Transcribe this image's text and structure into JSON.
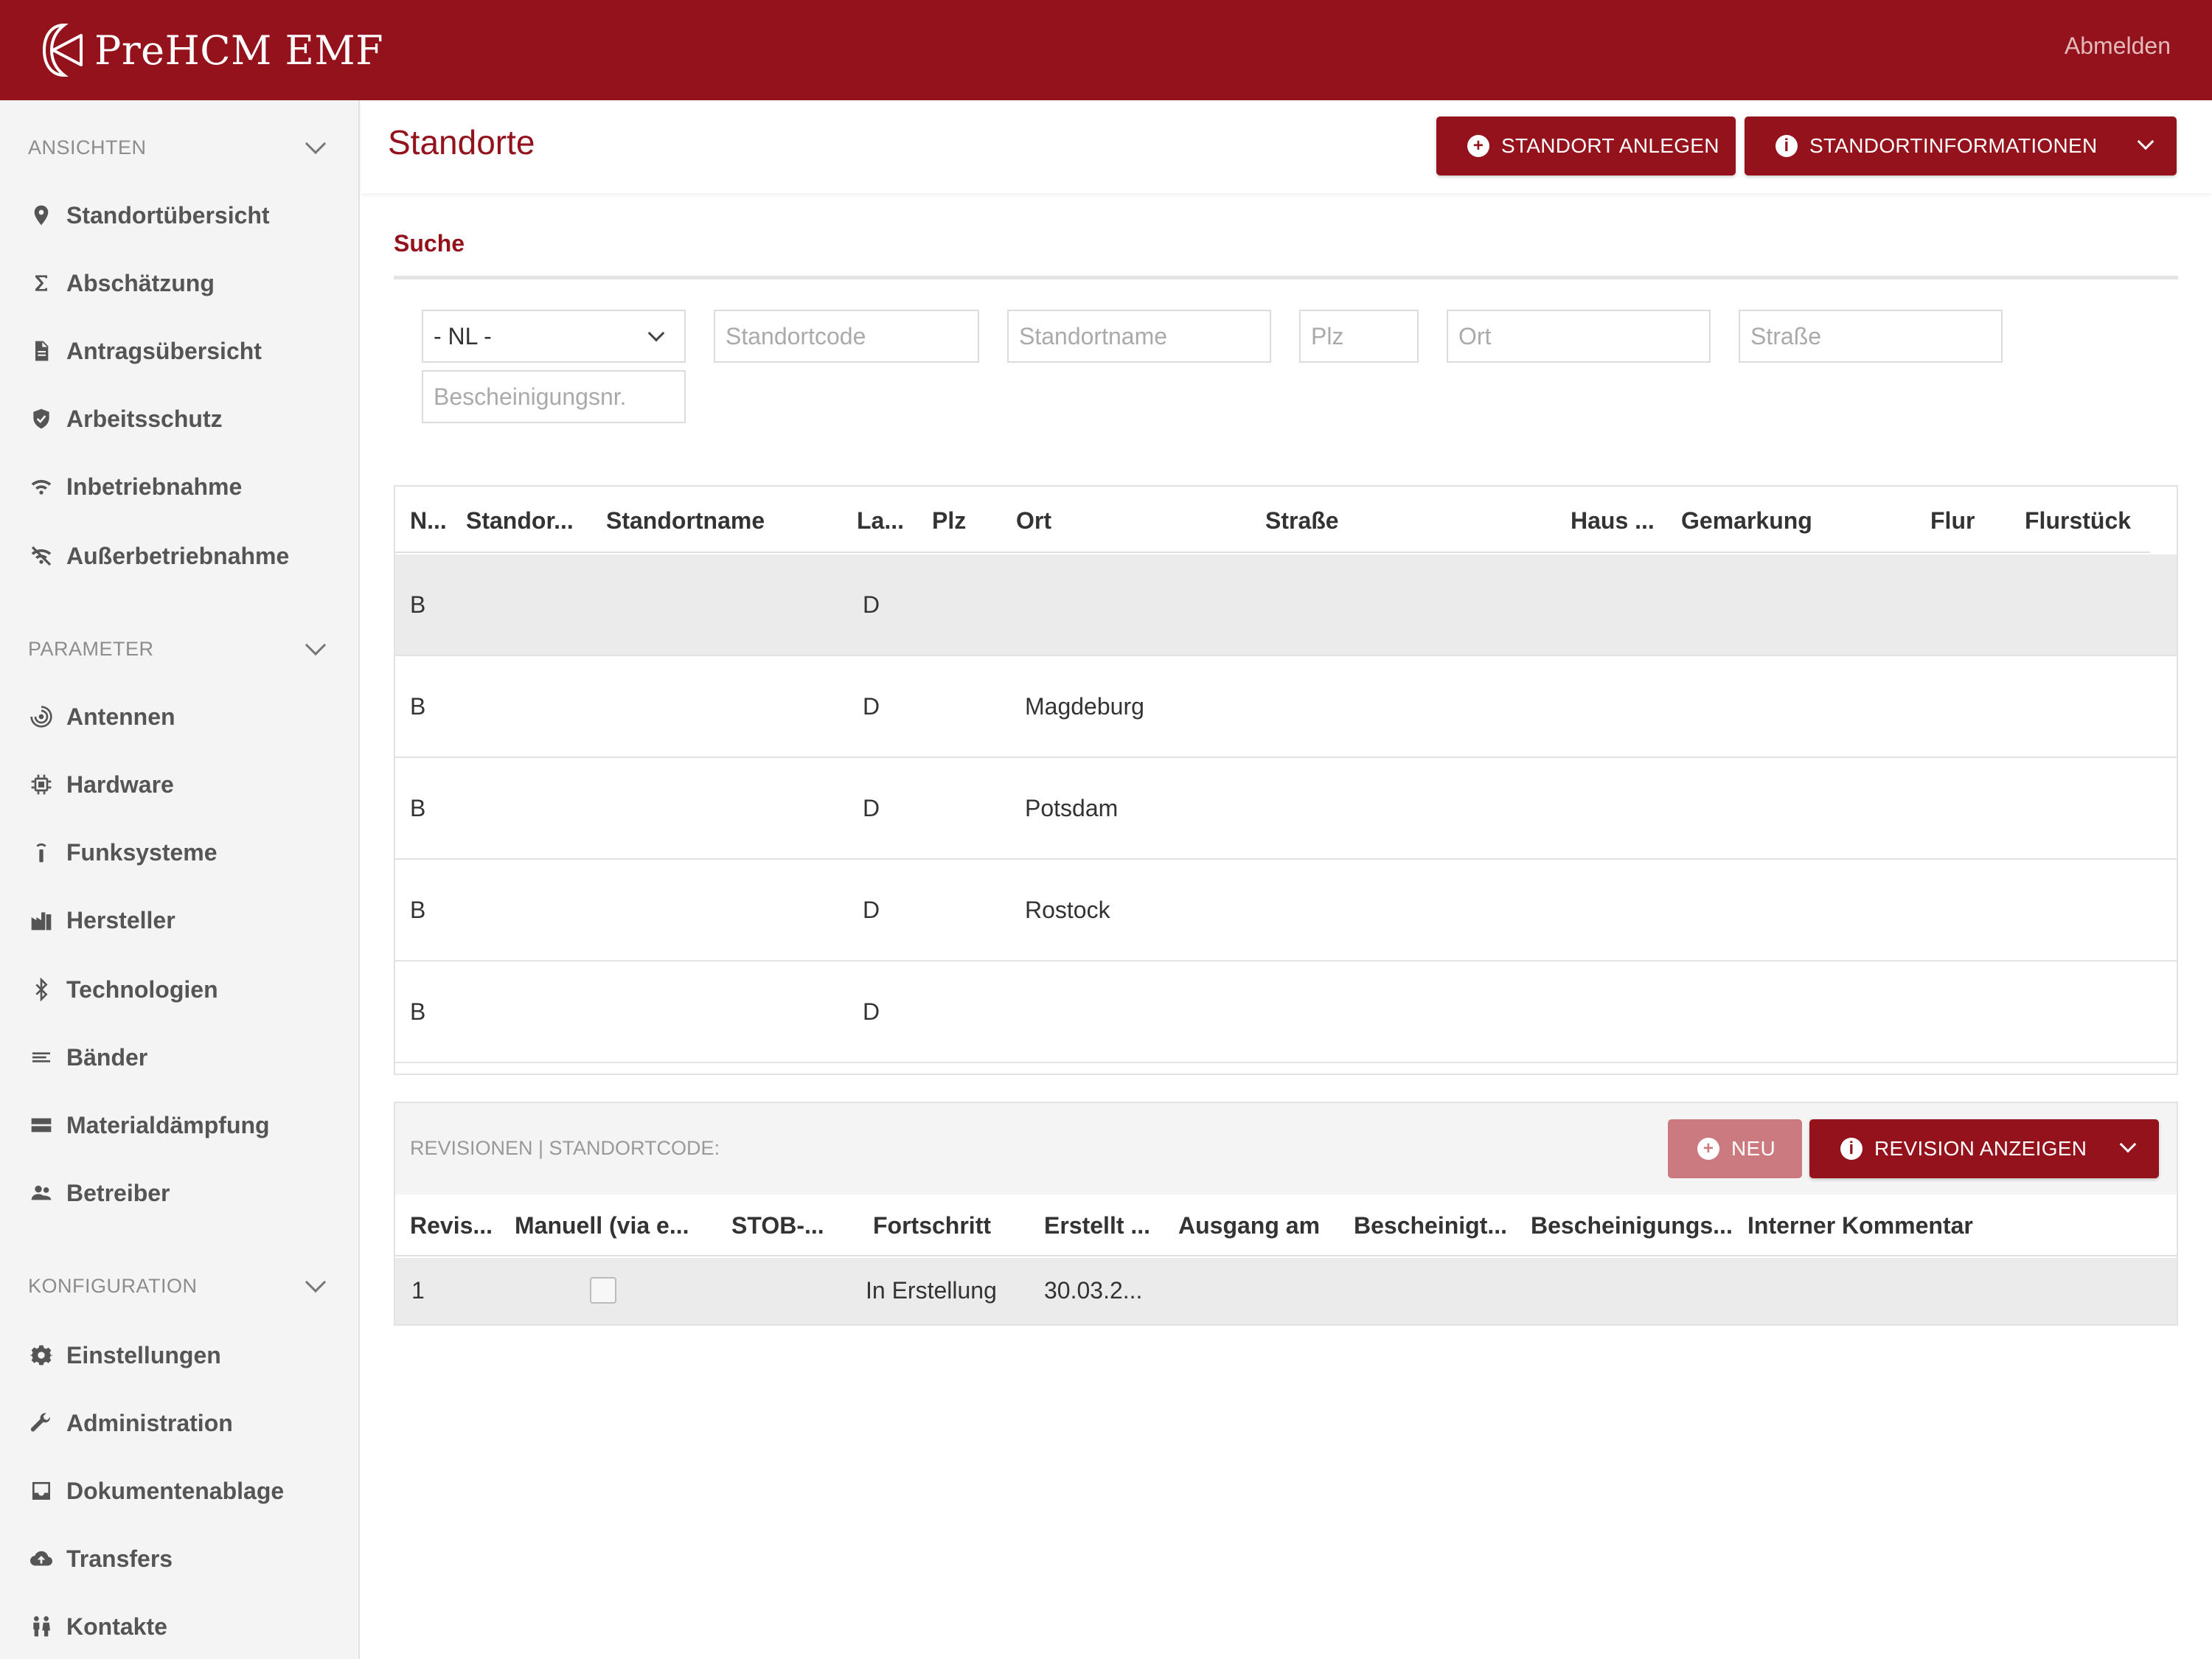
{
  "header": {
    "brand": "PreHCM  EMF",
    "logout": "Abmelden"
  },
  "sidebar": {
    "sections": [
      {
        "title": "ANSICHTEN",
        "items": [
          {
            "label": "Standortübersicht",
            "icon": "map-marker-icon"
          },
          {
            "label": "Abschätzung",
            "icon": "sigma-icon"
          },
          {
            "label": "Antragsübersicht",
            "icon": "document-icon"
          },
          {
            "label": "Arbeitsschutz",
            "icon": "shield-icon"
          },
          {
            "label": "Inbetriebnahme",
            "icon": "wifi-icon"
          },
          {
            "label": "Außerbetriebnahme",
            "icon": "wifi-off-icon"
          }
        ]
      },
      {
        "title": "PARAMETER",
        "items": [
          {
            "label": "Antennen",
            "icon": "antenna-icon"
          },
          {
            "label": "Hardware",
            "icon": "chip-icon"
          },
          {
            "label": "Funksysteme",
            "icon": "radio-tower-icon"
          },
          {
            "label": "Hersteller",
            "icon": "factory-icon"
          },
          {
            "label": "Technologien",
            "icon": "bluetooth-icon"
          },
          {
            "label": "Bänder",
            "icon": "lines-icon"
          },
          {
            "label": "Materialdämpfung",
            "icon": "layers-icon"
          },
          {
            "label": "Betreiber",
            "icon": "users-icon"
          }
        ]
      },
      {
        "title": "KONFIGURATION",
        "items": [
          {
            "label": "Einstellungen",
            "icon": "gear-icon"
          },
          {
            "label": "Administration",
            "icon": "wrench-icon"
          },
          {
            "label": "Dokumentenablage",
            "icon": "inbox-icon"
          },
          {
            "label": "Transfers",
            "icon": "cloud-upload-icon"
          },
          {
            "label": "Kontakte",
            "icon": "contacts-icon"
          }
        ]
      }
    ]
  },
  "main": {
    "title": "Standorte",
    "buttons": {
      "create": "STANDORT ANLEGEN",
      "info": "STANDORTINFORMATIONEN"
    },
    "search": {
      "label": "Suche",
      "nl_value": "- NL -",
      "placeholders": {
        "code": "Standortcode",
        "name": "Standortname",
        "plz": "Plz",
        "ort": "Ort",
        "strasse": "Straße",
        "bescheinigung": "Bescheinigungsnr."
      }
    },
    "grid": {
      "columns": [
        "N...",
        "Standor...",
        "Standortname",
        "La...",
        "Plz",
        "Ort",
        "Straße",
        "Haus ...",
        "Gemarkung",
        "Flur",
        "Flurstück"
      ],
      "rows": [
        {
          "n": "B",
          "la": "D",
          "ort": ""
        },
        {
          "n": "B",
          "la": "D",
          "ort": "Magdeburg"
        },
        {
          "n": "B",
          "la": "D",
          "ort": "Potsdam"
        },
        {
          "n": "B",
          "la": "D",
          "ort": "Rostock"
        },
        {
          "n": "B",
          "la": "D",
          "ort": ""
        }
      ]
    },
    "revisions": {
      "title": "REVISIONEN | STANDORTCODE:",
      "new_label": "NEU",
      "show_label": "REVISION ANZEIGEN",
      "columns": [
        "Revis...",
        "Manuell (via e...",
        "STOB-...",
        "Fortschritt",
        "Erstellt ...",
        "Ausgang am",
        "Bescheinigt...",
        "Bescheinigungs...",
        "Interner Kommentar"
      ],
      "rows": [
        {
          "revision": "1",
          "fortschritt": "In Erstellung",
          "erstellt": "30.03.2..."
        }
      ]
    }
  },
  "colors": {
    "brand": "#93121b",
    "brand_light": "#cb7a7f",
    "sidebar_bg": "#f4f4f4"
  }
}
